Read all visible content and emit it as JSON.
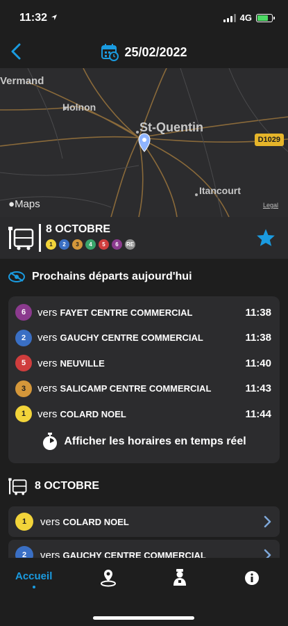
{
  "status": {
    "time": "11:32",
    "network": "4G"
  },
  "nav": {
    "date": "25/02/2022"
  },
  "map": {
    "labels": {
      "vermand": "Vermand",
      "holnon": "Holnon",
      "stquentin": "St-Quentin",
      "itancourt": "Itancourt"
    },
    "road_badge": "D1029",
    "logo": "Maps",
    "legal": "Legal"
  },
  "stop": {
    "name": "8 OCTOBRE",
    "lines": [
      {
        "label": "1",
        "color": "#f2d43a",
        "text_color": "#1e1e1e"
      },
      {
        "label": "2",
        "color": "#3a6fc4",
        "text_color": "#ffffff"
      },
      {
        "label": "3",
        "color": "#d4973a",
        "text_color": "#1e1e1e"
      },
      {
        "label": "4",
        "color": "#3aa66b",
        "text_color": "#ffffff"
      },
      {
        "label": "5",
        "color": "#cf3d3d",
        "text_color": "#ffffff"
      },
      {
        "label": "6",
        "color": "#8b3a8e",
        "text_color": "#ffffff"
      },
      {
        "label": "RE",
        "color": "#8e8e8e",
        "text_color": "#ffffff"
      }
    ]
  },
  "departures": {
    "title": "Prochains départs aujourd'hui",
    "items": [
      {
        "line": "6",
        "color": "#8b3a8e",
        "text_color": "#ffffff",
        "vers": "vers",
        "destination": "FAYET CENTRE COMMERCIAL",
        "time": "11:38"
      },
      {
        "line": "2",
        "color": "#3a6fc4",
        "text_color": "#ffffff",
        "vers": "vers",
        "destination": "GAUCHY CENTRE COMMERCIAL",
        "time": "11:38"
      },
      {
        "line": "5",
        "color": "#cf3d3d",
        "text_color": "#ffffff",
        "vers": "vers",
        "destination": "NEUVILLE",
        "time": "11:40"
      },
      {
        "line": "3",
        "color": "#d4973a",
        "text_color": "#1e1e1e",
        "vers": "vers",
        "destination": "SALICAMP CENTRE COMMERCIAL",
        "time": "11:43"
      },
      {
        "line": "1",
        "color": "#f2d43a",
        "text_color": "#1e1e1e",
        "vers": "vers",
        "destination": "COLARD NOEL",
        "time": "11:44"
      }
    ],
    "realtime_label": "Afficher les horaires en temps réel"
  },
  "stop_section": {
    "title": "8 OCTOBRE",
    "rows": [
      {
        "line": "1",
        "color": "#f2d43a",
        "text_color": "#1e1e1e",
        "vers": "vers",
        "destination": "COLARD NOEL"
      },
      {
        "line": "2",
        "color": "#3a6fc4",
        "text_color": "#ffffff",
        "vers": "vers",
        "destination": "GAUCHY CENTRE COMMERCIAL"
      }
    ]
  },
  "tabs": {
    "home": "Accueil"
  },
  "colors": {
    "accent": "#1a9be0",
    "background": "#1e1e1e",
    "card": "#2c2c2e"
  }
}
